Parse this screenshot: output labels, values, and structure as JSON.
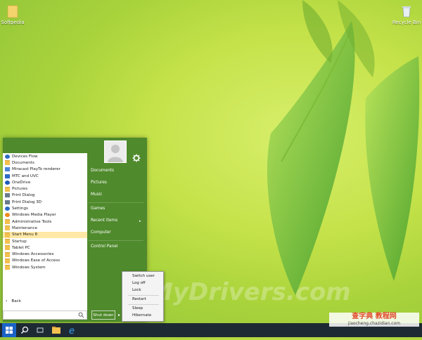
{
  "desktop": {
    "icons": [
      {
        "label": "Softpedia",
        "icon": "folder-icon"
      },
      {
        "label": "Recycle Bin",
        "icon": "recycle-bin-icon"
      }
    ]
  },
  "start_menu": {
    "programs": [
      {
        "label": "Devices Flow",
        "icon": "gear-app-icon",
        "color": "#2b6cc4"
      },
      {
        "label": "Documents",
        "icon": "folder-icon",
        "color": "#f3c04f"
      },
      {
        "label": "Miracast PlayTo renderer",
        "icon": "window-icon",
        "color": "#4a86d8"
      },
      {
        "label": "MTC and UVC",
        "icon": "music-icon",
        "color": "#2b6cc4"
      },
      {
        "label": "OneDrive",
        "icon": "cloud-icon",
        "color": "#1e5bb8"
      },
      {
        "label": "Pictures",
        "icon": "folder-icon",
        "color": "#f3c04f"
      },
      {
        "label": "Print Dialog",
        "icon": "printer-icon",
        "color": "#6a7b8c"
      },
      {
        "label": "Print Dialog 3D",
        "icon": "printer-icon",
        "color": "#6a7b8c"
      },
      {
        "label": "Settings",
        "icon": "gear-app-icon",
        "color": "#2b6cc4"
      },
      {
        "label": "Windows Media Player",
        "icon": "media-player-icon",
        "color": "#f08a1c"
      },
      {
        "label": "Administrative Tools",
        "icon": "folder-icon",
        "color": "#f3c04f"
      },
      {
        "label": "Maintenance",
        "icon": "folder-icon",
        "color": "#f3c04f"
      },
      {
        "label": "Start Menu 8",
        "icon": "folder-icon",
        "color": "#f3c04f",
        "selected": true
      },
      {
        "label": "Startup",
        "icon": "folder-icon",
        "color": "#f3c04f"
      },
      {
        "label": "Tablet PC",
        "icon": "folder-icon",
        "color": "#f3c04f"
      },
      {
        "label": "Windows Accessories",
        "icon": "folder-icon",
        "color": "#f3c04f"
      },
      {
        "label": "Windows Ease of Access",
        "icon": "folder-icon",
        "color": "#f3c04f"
      },
      {
        "label": "Windows System",
        "icon": "folder-icon",
        "color": "#f3c04f"
      }
    ],
    "back_label": "Back",
    "search_placeholder": "",
    "right_links": [
      {
        "label": "Documents"
      },
      {
        "label": "Pictures"
      },
      {
        "label": "Music"
      },
      {
        "label": "Games"
      },
      {
        "label": "Recent Items"
      },
      {
        "label": "Computer"
      },
      {
        "label": "Control Panel"
      }
    ],
    "shutdown_label": "Shut down",
    "accent_color": "#4f8a2c"
  },
  "power_menu": {
    "items": [
      {
        "label": "Switch user"
      },
      {
        "label": "Log off"
      },
      {
        "label": "Lock"
      },
      {
        "label": "Restart"
      },
      {
        "label": "Sleep"
      },
      {
        "label": "Hibernate"
      }
    ]
  },
  "taskbar": {
    "buttons": [
      "windows-start-icon",
      "search-icon",
      "task-view-icon",
      "file-explorer-icon",
      "internet-explorer-icon"
    ]
  },
  "watermark": {
    "text": "MyDrivers.com",
    "site_big": "查字典 教程网",
    "site_url": "jiaocheng.chazidian.com"
  }
}
